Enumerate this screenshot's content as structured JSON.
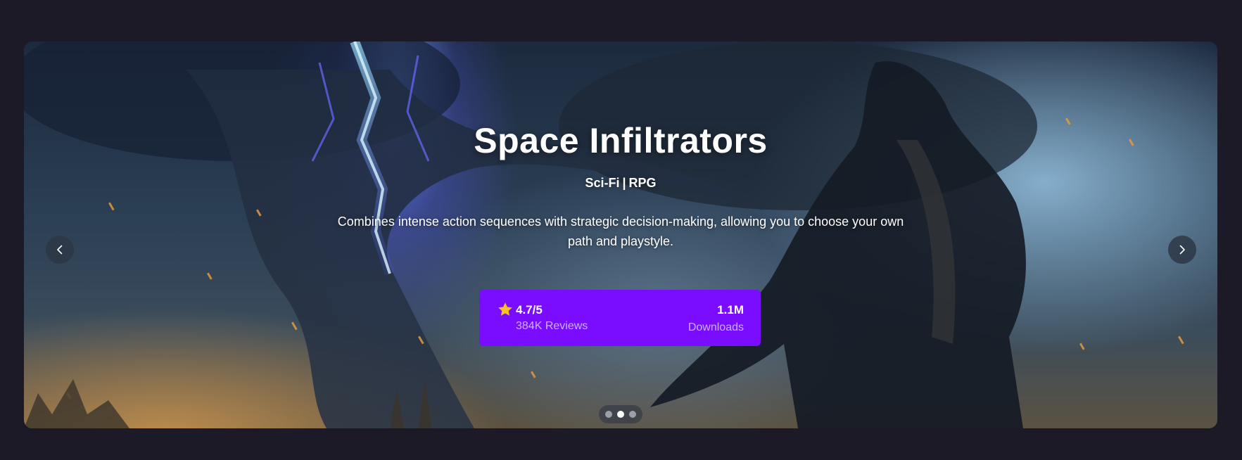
{
  "hero": {
    "title": "Space Infiltrators",
    "genres": [
      "Sci-Fi",
      "RPG"
    ],
    "genre_separator": "|",
    "description": "Combines intense action sequences with strategic decision-making, allowing you to choose your own path and playstyle.",
    "background_image": "dark-fantasy-warrior-lightning-scene"
  },
  "stats": {
    "rating": "4.7/5",
    "reviews": "384K Reviews",
    "downloads": "1.1M",
    "downloads_label": "Downloads",
    "rating_icon": "star-icon"
  },
  "carousel": {
    "prev_icon": "chevron-left-icon",
    "next_icon": "chevron-right-icon",
    "slide_count": 3,
    "active_slide": 2
  },
  "colors": {
    "page_background": "#1b1a26",
    "accent": "#7a0cff",
    "star": "#fbc02d"
  }
}
